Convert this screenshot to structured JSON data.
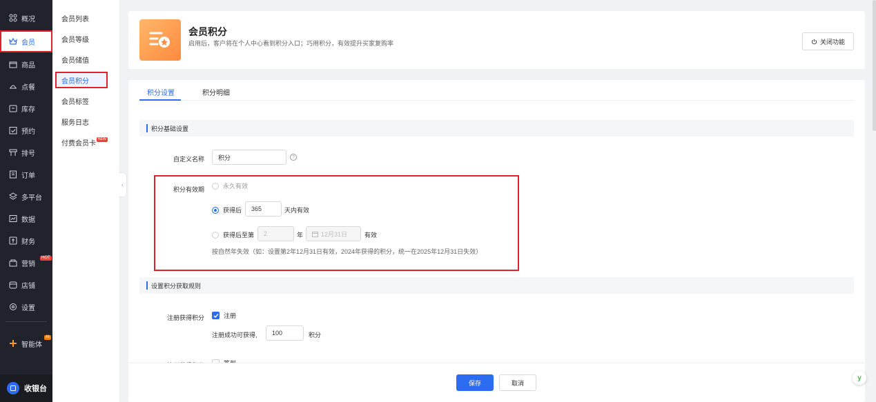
{
  "sidebar": {
    "items": [
      {
        "label": "概况",
        "icon": "dashboard-icon"
      },
      {
        "label": "会员",
        "icon": "crown-icon"
      },
      {
        "label": "商品",
        "icon": "shop-icon"
      },
      {
        "label": "点餐",
        "icon": "dish-icon"
      },
      {
        "label": "库存",
        "icon": "inventory-icon"
      },
      {
        "label": "预约",
        "icon": "calendar-check-icon"
      },
      {
        "label": "排号",
        "icon": "queue-icon"
      },
      {
        "label": "订单",
        "icon": "order-icon"
      },
      {
        "label": "多平台",
        "icon": "layers-icon"
      },
      {
        "label": "数据",
        "icon": "chart-icon"
      },
      {
        "label": "财务",
        "icon": "finance-icon"
      },
      {
        "label": "营销",
        "icon": "marketing-icon",
        "badge": "HOT"
      },
      {
        "label": "店铺",
        "icon": "store-icon"
      },
      {
        "label": "设置",
        "icon": "gear-icon"
      },
      {
        "label": "智能体",
        "icon": "agent-icon",
        "badge": "AI"
      }
    ],
    "bottom_label": "收银台"
  },
  "submenu": {
    "items": [
      {
        "label": "会员列表"
      },
      {
        "label": "会员等级"
      },
      {
        "label": "会员储值"
      },
      {
        "label": "会员积分"
      },
      {
        "label": "会员标签"
      },
      {
        "label": "服务日志"
      },
      {
        "label": "付费会员卡",
        "badge": "NEW"
      }
    ]
  },
  "header": {
    "title": "会员积分",
    "desc": "启用后，客户将在个人中心看到积分入口；巧用积分，有效提升买家复购率",
    "close_label": "关闭功能"
  },
  "tabs": [
    {
      "label": "积分设置"
    },
    {
      "label": "积分明细"
    }
  ],
  "basic": {
    "section_title": "积分基础设置",
    "name_label": "自定义名称",
    "name_value": "积分",
    "validity_label": "积分有效期",
    "opt_forever": "永久有效",
    "opt_days_prefix": "获得后",
    "opt_days_value": "365",
    "opt_days_suffix": "天内有效",
    "opt_year_prefix": "获得后至第",
    "opt_year_value": "2",
    "opt_year_unit": "年",
    "opt_date_value": "12月31日",
    "opt_year_suffix": "有效",
    "hint": "按自然年失效（如：设置第2年12月31日有效，2024年获得的积分，统一在2025年12月31日失效）"
  },
  "rules": {
    "section_title": "设置积分获取规则",
    "register_label": "注册获得积分",
    "register_check": "注册",
    "register_desc": "注册成功可获得,",
    "register_value": "100",
    "register_unit": "积分",
    "signin_label": "签到获得积分",
    "signin_check": "签到"
  },
  "footer": {
    "save": "保存",
    "cancel": "取消"
  },
  "colors": {
    "primary": "#2b6cf0",
    "sidebar_bg": "#20232b",
    "highlight": "#e0202a",
    "accent_orange": "#ff8a3d"
  }
}
